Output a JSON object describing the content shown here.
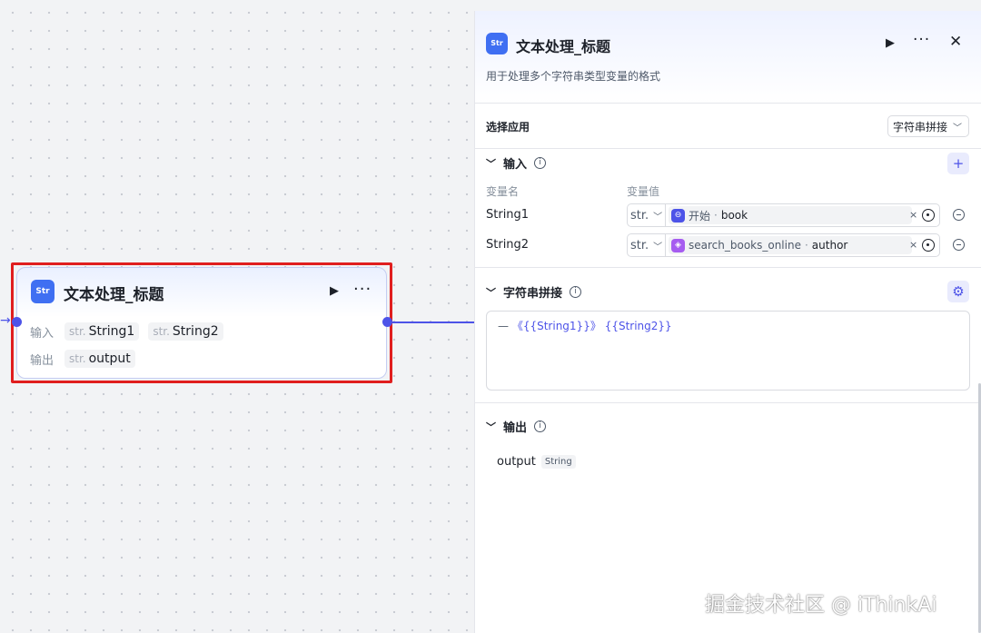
{
  "node": {
    "icon_text": "Str",
    "title": "文本处理_标题",
    "run_icon": "▶",
    "more_icon": "···",
    "input_label": "输入",
    "output_label": "输出",
    "inputs": [
      {
        "type": "str.",
        "name": "String1"
      },
      {
        "type": "str.",
        "name": "String2"
      }
    ],
    "output": {
      "type": "str.",
      "name": "output"
    }
  },
  "panel": {
    "icon_text": "Str",
    "title": "文本处理_标题",
    "run_icon": "▶",
    "more_icon": "···",
    "close_icon": "✕",
    "description": "用于处理多个字符串类型变量的格式",
    "app_label": "选择应用",
    "app_value": "字符串拼接",
    "input_section": {
      "title": "输入",
      "col_name": "变量名",
      "col_value": "变量值",
      "add_icon": "+",
      "rows": [
        {
          "name": "String1",
          "type": "str.",
          "source": "开始",
          "sep": "·",
          "field": "book",
          "icon_color": "#4d53e8"
        },
        {
          "name": "String2",
          "type": "str.",
          "source": "search_books_online",
          "sep": "·",
          "field": "author",
          "icon_color": "#a65cf0"
        }
      ]
    },
    "concat_section": {
      "title": "字符串拼接",
      "settings_icon": "⚙",
      "template_prefix": "—",
      "template_open": "《",
      "template_var1": "{{String1}}",
      "template_close": "》",
      "template_var2": "{{String2}}"
    },
    "output_section": {
      "title": "输出",
      "name": "output",
      "type": "String"
    }
  },
  "watermark": "掘金技术社区 @ iThinkAi",
  "colors": {
    "accent": "#4d53e8",
    "node_icon": "#3f6ff2",
    "highlight": "#e01e1e"
  }
}
